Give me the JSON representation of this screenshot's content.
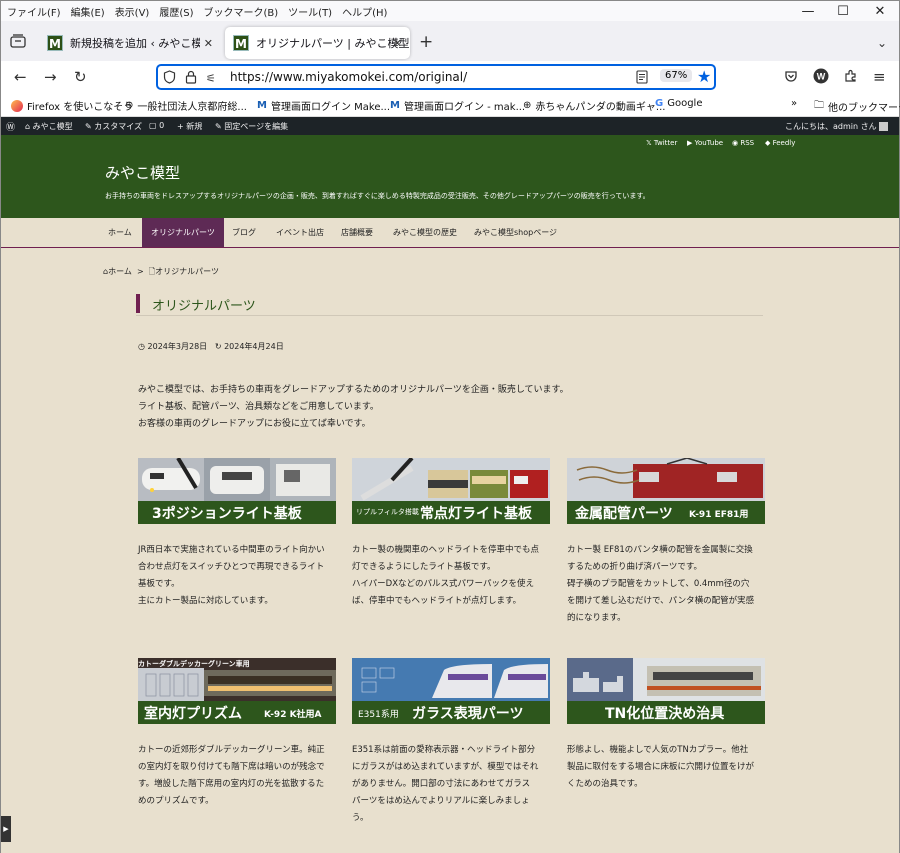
{
  "browser": {
    "menu": [
      "ファイル(F)",
      "編集(E)",
      "表示(V)",
      "履歴(S)",
      "ブックマーク(B)",
      "ツール(T)",
      "ヘルプ(H)"
    ],
    "window_controls": [
      "—",
      "☐",
      "✕"
    ],
    "tabs": [
      {
        "label": "新規投稿を追加 ‹ みやこ模型 — W"
      },
      {
        "label": "オリジナルパーツ | みやこ模型"
      }
    ],
    "new_tab": "+",
    "url": "https://www.miyakomokei.com/original/",
    "zoom": "67%",
    "bookmarks": [
      "Firefox を使いこなそう",
      "一般社団法人京都府総...",
      "管理画面ログイン Make...",
      "管理画面ログイン - mak...",
      "赤ちゃんパンダの動画ギャ...",
      "Google",
      "他のブックマーク"
    ]
  },
  "wp_admin": {
    "site": "みやこ模型",
    "customize": "カスタマイズ",
    "comments": "0",
    "new": "新規",
    "edit": "固定ページを編集",
    "greeting": "こんにちは、admin さん"
  },
  "site": {
    "social": [
      "Twitter",
      "YouTube",
      "RSS",
      "Feedly"
    ],
    "title": "みやこ模型",
    "description": "お手持ちの車両をドレスアップするオリジナルパーツの企画・販売、到着すればすぐに楽しめる特製完成品の受注販売、その他グレードアップパーツの販売を行っています。",
    "nav": [
      "ホーム",
      "オリジナルパーツ",
      "ブログ",
      "イベント出店",
      "店舗概要",
      "みやこ模型の歴史",
      "みやこ模型shopページ"
    ]
  },
  "page": {
    "breadcrumb": {
      "home": "ホーム",
      "sep": ">",
      "current": "オリジナルパーツ"
    },
    "title": "オリジナルパーツ",
    "published": "2024年3月28日",
    "updated": "2024年4月24日",
    "intro": [
      "みやこ模型では、お手持ちの車両をグレードアップするためのオリジナルパーツを企画・販売しています。",
      "ライト基板、配管パーツ、治具類などをご用意しています。",
      "お客様の車両のグレードアップにお役に立てば幸いです。"
    ]
  },
  "products": [
    {
      "title": "3ポジションライト基板",
      "sub": "",
      "tag": "",
      "desc": [
        "JR西日本で実施されている中間車のライト向かい",
        "合わせ点灯をスイッチひとつで再現できるライト",
        "基板です。",
        "主にカトー製品に対応しています。"
      ]
    },
    {
      "title": "常点灯ライト基板",
      "sub": "",
      "tag": "リプルフィルタ搭載",
      "desc": [
        "カトー製の機関車のヘッドライトを停車中でも点",
        "灯できるようにしたライト基板です。",
        "ハイパーDXなどのパルス式パワーパックを使え",
        "ば、停車中でもヘッドライトが点灯します。"
      ]
    },
    {
      "title": "金属配管パーツ",
      "sub": "K-91 EF81用",
      "tag": "",
      "desc": [
        "カトー製 EF81のパンタ横の配管を金属製に交換",
        "するための折り曲げ済パーツです。",
        "碍子横のプラ配管をカットして、0.4mm径の穴",
        "を開けて差し込むだけで、パンタ横の配管が実感",
        "的になります。"
      ]
    },
    {
      "title": "室内灯プリズム",
      "sub": "K-92 K社用A",
      "tag": "カトーダブルデッカーグリーン車用",
      "desc": [
        "カトーの近郊形ダブルデッカーグリーン車。純正",
        "の室内灯を取り付けても階下席は暗いのが残念で",
        "す。増設した階下席用の室内灯の光を拡散するた",
        "めのプリズムです。"
      ]
    },
    {
      "title": "ガラス表現パーツ",
      "sub": "",
      "tag": "E351系用",
      "desc": [
        "E351系は前面の愛称表示器・ヘッドライト部分",
        "にガラスがはめ込まれていますが、模型ではそれ",
        "がありません。開口部の寸法にあわせてガラス",
        "パーツをはめ込んでよりリアルに楽しみましょ",
        "う。"
      ]
    },
    {
      "title": "TN化位置決め治具",
      "sub": "",
      "tag": "",
      "desc": [
        "形態よし、機能よしで人気のTNカプラー。他社",
        "製品に取付をする場合に床板に穴開け位置をけが",
        "くための治具です。"
      ]
    }
  ],
  "colors": {
    "header_green": "#2d561c",
    "accent_purple": "#5e2a55",
    "page_bg": "#e8e0ce",
    "focus_blue": "#0061e0"
  }
}
